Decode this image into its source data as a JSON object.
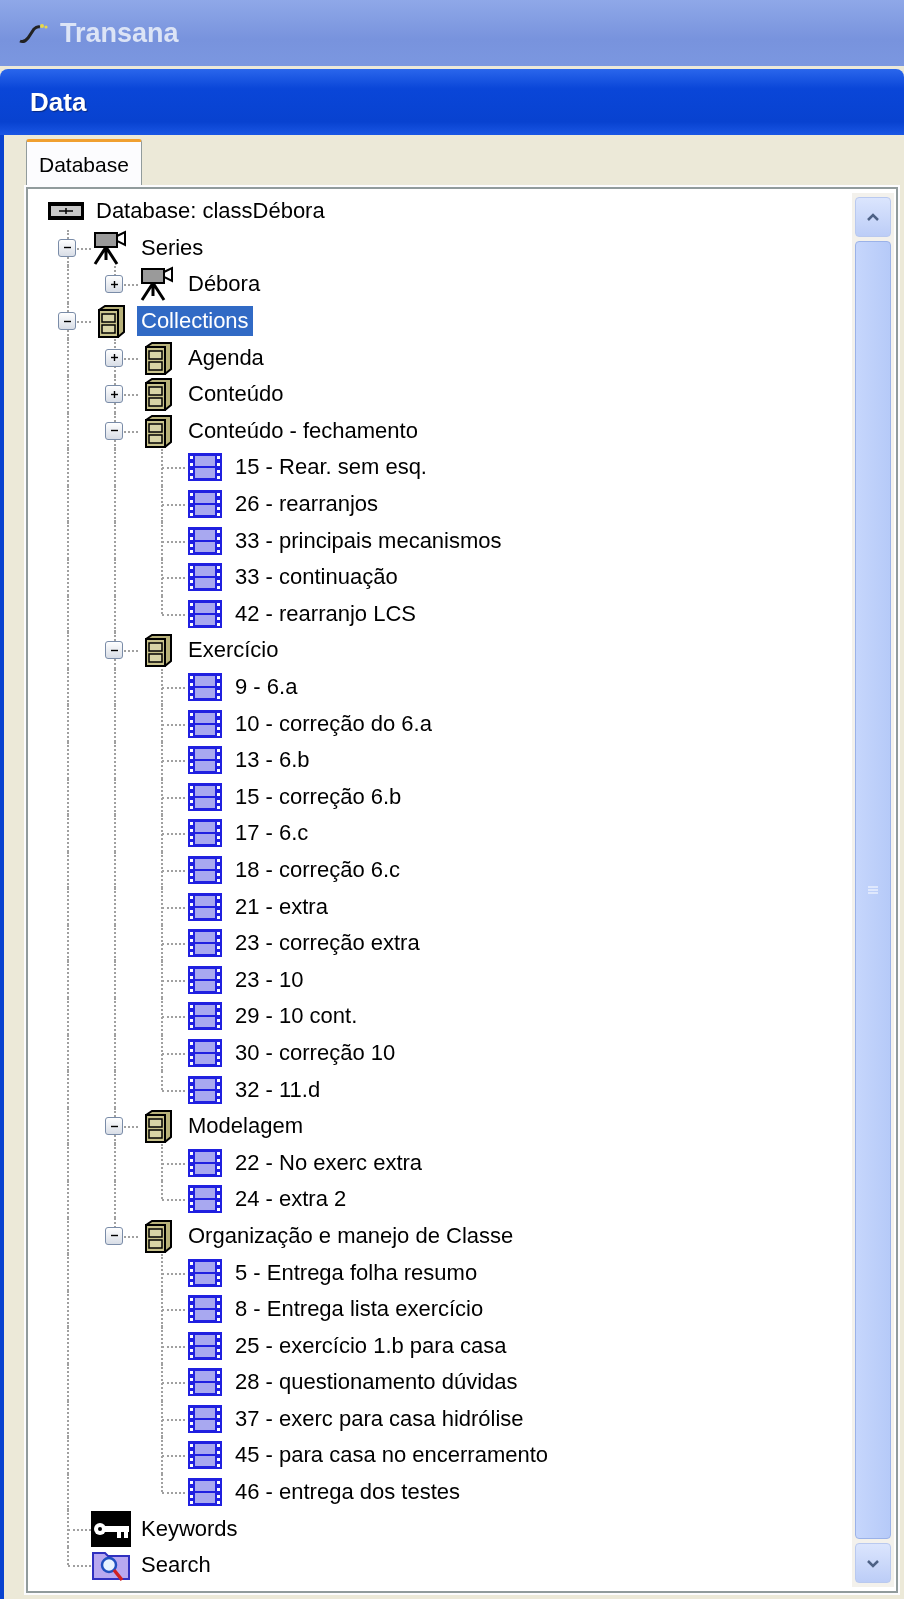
{
  "app_window": {
    "title": "Transana"
  },
  "panel": {
    "title": "Data"
  },
  "tabs": [
    {
      "label": "Database",
      "selected": true
    }
  ],
  "tree": {
    "label": "Database: classDébora",
    "kind": "database",
    "selected": false,
    "children": [
      {
        "label": "Series",
        "kind": "series",
        "expanded": true,
        "selected": false,
        "children": [
          {
            "label": "Débora",
            "kind": "series",
            "expanded": false,
            "selected": false
          }
        ]
      },
      {
        "label": "Collections",
        "kind": "collection",
        "expanded": true,
        "selected": true,
        "children": [
          {
            "label": "Agenda",
            "kind": "collection",
            "expanded": false,
            "selected": false
          },
          {
            "label": "Conteúdo",
            "kind": "collection",
            "expanded": false,
            "selected": false
          },
          {
            "label": "Conteúdo - fechamento",
            "kind": "collection",
            "expanded": true,
            "selected": false,
            "children": [
              {
                "label": "15 - Rear. sem esq.",
                "kind": "clip",
                "selected": false
              },
              {
                "label": "26 - rearranjos",
                "kind": "clip",
                "selected": false
              },
              {
                "label": "33 - principais mecanismos",
                "kind": "clip",
                "selected": false
              },
              {
                "label": "33 - continuação",
                "kind": "clip",
                "selected": false
              },
              {
                "label": "42 - rearranjo LCS",
                "kind": "clip",
                "selected": false
              }
            ]
          },
          {
            "label": "Exercício",
            "kind": "collection",
            "expanded": true,
            "selected": false,
            "children": [
              {
                "label": "9 - 6.a",
                "kind": "clip",
                "selected": false
              },
              {
                "label": "10 - correção do 6.a",
                "kind": "clip",
                "selected": false
              },
              {
                "label": "13 - 6.b",
                "kind": "clip",
                "selected": false
              },
              {
                "label": "15 - correção 6.b",
                "kind": "clip",
                "selected": false
              },
              {
                "label": "17 - 6.c",
                "kind": "clip",
                "selected": false
              },
              {
                "label": "18 - correção 6.c",
                "kind": "clip",
                "selected": false
              },
              {
                "label": "21 - extra",
                "kind": "clip",
                "selected": false
              },
              {
                "label": "23 - correção extra",
                "kind": "clip",
                "selected": false
              },
              {
                "label": "23 - 10",
                "kind": "clip",
                "selected": false
              },
              {
                "label": "29 - 10 cont.",
                "kind": "clip",
                "selected": false
              },
              {
                "label": "30 - correção 10",
                "kind": "clip",
                "selected": false
              },
              {
                "label": "32 - 11.d",
                "kind": "clip",
                "selected": false
              }
            ]
          },
          {
            "label": "Modelagem",
            "kind": "collection",
            "expanded": true,
            "selected": false,
            "children": [
              {
                "label": "22 - No exerc extra",
                "kind": "clip",
                "selected": false
              },
              {
                "label": "24 - extra 2",
                "kind": "clip",
                "selected": false
              }
            ]
          },
          {
            "label": "Organização e manejo de Classe",
            "kind": "collection",
            "expanded": true,
            "selected": false,
            "children": [
              {
                "label": "5 - Entrega folha resumo",
                "kind": "clip",
                "selected": false
              },
              {
                "label": "8 - Entrega lista exercício",
                "kind": "clip",
                "selected": false
              },
              {
                "label": "25 - exercício 1.b para casa",
                "kind": "clip",
                "selected": false
              },
              {
                "label": "28 - questionamento dúvidas",
                "kind": "clip",
                "selected": false
              },
              {
                "label": "37 - exerc para casa hidrólise",
                "kind": "clip",
                "selected": false
              },
              {
                "label": "45 - para casa no encerramento",
                "kind": "clip",
                "selected": false
              },
              {
                "label": "46 - entrega dos testes",
                "kind": "clip",
                "selected": false
              }
            ]
          }
        ]
      },
      {
        "label": "Keywords",
        "kind": "keywords",
        "selected": false
      },
      {
        "label": "Search",
        "kind": "search",
        "selected": false
      }
    ]
  }
}
